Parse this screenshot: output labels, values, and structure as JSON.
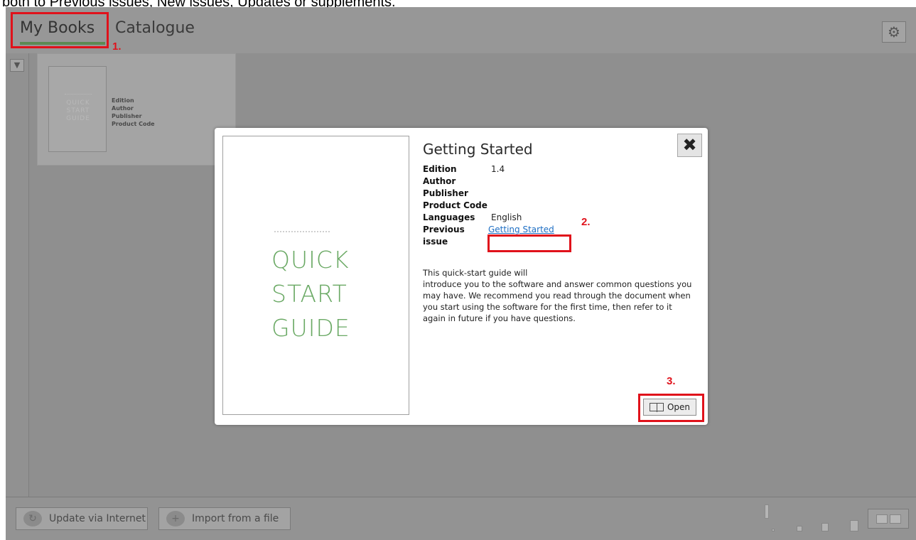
{
  "caption": {
    "text": "both to Previous issues, New issues, Updates or supplements."
  },
  "tabs": {
    "my_books": "My Books",
    "catalogue": "Catalogue"
  },
  "book_card": {
    "cover_title": "QUICK\nSTART\nGUIDE",
    "meta": [
      "Edition",
      "Author",
      "Publisher",
      "Product Code"
    ]
  },
  "dialog": {
    "title": "Getting Started",
    "close_icon": "close-icon",
    "cover_title_lines": [
      "QUICK",
      "START",
      "GUIDE"
    ],
    "fields": {
      "edition_label": "Edition",
      "edition_value": "1.4",
      "author_label": "Author",
      "publisher_label": "Publisher",
      "product_code_label": "Product Code",
      "languages_label": "Languages",
      "languages_value": "English",
      "previous_issue_label": "Previous issue",
      "previous_issue_value": "Getting Started"
    },
    "description": "This quick-start guide will\nintroduce you to the software and answer common questions you may have. We recommend you read through the document when you start using the software for the first time, then refer to it again in future if you have questions.",
    "open_label": "Open"
  },
  "bottom_bar": {
    "update_label": "Update via Internet",
    "import_label": "Import from a file"
  },
  "annotations": {
    "one": "1.",
    "two": "2.",
    "three": "3."
  },
  "colors": {
    "annotation_red": "#e0121b",
    "cover_green": "#6aa964",
    "tab_underline": "#5c8a53",
    "link_blue": "#1f6fc4"
  }
}
